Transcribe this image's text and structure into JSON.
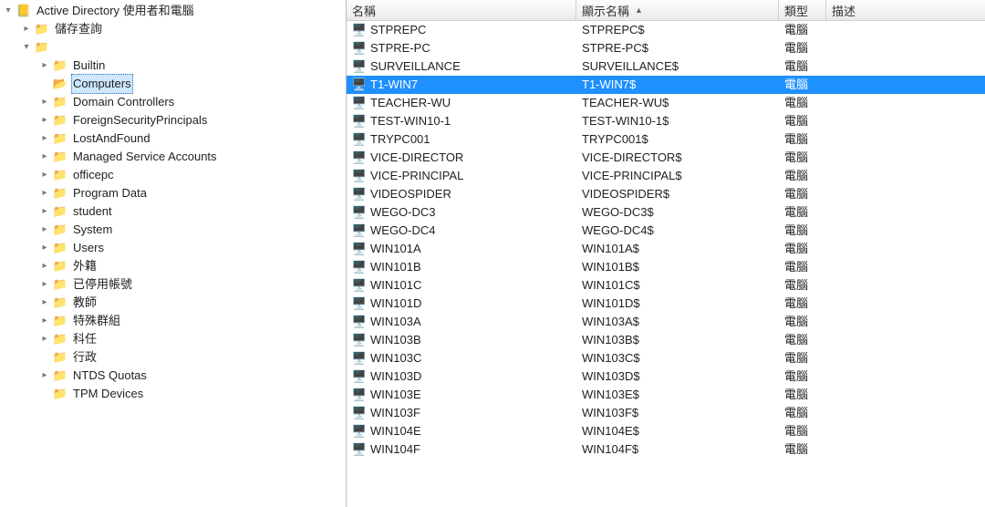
{
  "icons": {
    "folder": "📁",
    "folder_open": "📂",
    "ad_root": "📒",
    "container": "📁",
    "ou": "📁",
    "computer": "🖥️"
  },
  "colors": {
    "selection": "#1e90ff",
    "tree_selection": "#cde8ff",
    "border": "#bdbdbd"
  },
  "tree": {
    "root_label": "Active Directory 使用者和電腦",
    "nodes": [
      {
        "label": "儲存查詢",
        "depth": 1,
        "icon": "folder",
        "expander": "collapsed"
      },
      {
        "label": "",
        "depth": 1,
        "icon": "container",
        "expander": "expanded",
        "redacted": true
      },
      {
        "label": "Builtin",
        "depth": 2,
        "icon": "folder",
        "expander": "collapsed"
      },
      {
        "label": "Computers",
        "depth": 2,
        "icon": "folder_open",
        "expander": "none",
        "selected": true
      },
      {
        "label": "Domain Controllers",
        "depth": 2,
        "icon": "ou",
        "expander": "collapsed"
      },
      {
        "label": "ForeignSecurityPrincipals",
        "depth": 2,
        "icon": "folder",
        "expander": "collapsed"
      },
      {
        "label": "LostAndFound",
        "depth": 2,
        "icon": "folder",
        "expander": "collapsed"
      },
      {
        "label": "Managed Service Accounts",
        "depth": 2,
        "icon": "folder",
        "expander": "collapsed"
      },
      {
        "label": "officepc",
        "depth": 2,
        "icon": "ou",
        "expander": "collapsed"
      },
      {
        "label": "Program Data",
        "depth": 2,
        "icon": "folder",
        "expander": "collapsed"
      },
      {
        "label": "student",
        "depth": 2,
        "icon": "ou",
        "expander": "collapsed"
      },
      {
        "label": "System",
        "depth": 2,
        "icon": "folder",
        "expander": "collapsed"
      },
      {
        "label": "Users",
        "depth": 2,
        "icon": "folder",
        "expander": "collapsed"
      },
      {
        "label": "外籍",
        "depth": 2,
        "icon": "ou",
        "expander": "collapsed"
      },
      {
        "label": "已停用帳號",
        "depth": 2,
        "icon": "ou",
        "expander": "collapsed"
      },
      {
        "label": "教師",
        "depth": 2,
        "icon": "ou",
        "expander": "collapsed"
      },
      {
        "label": "特殊群組",
        "depth": 2,
        "icon": "ou",
        "expander": "collapsed"
      },
      {
        "label": "科任",
        "depth": 2,
        "icon": "ou",
        "expander": "collapsed"
      },
      {
        "label": "行政",
        "depth": 2,
        "icon": "ou",
        "expander": "none"
      },
      {
        "label": "NTDS Quotas",
        "depth": 2,
        "icon": "folder",
        "expander": "collapsed"
      },
      {
        "label": "TPM Devices",
        "depth": 2,
        "icon": "folder",
        "expander": "none"
      }
    ]
  },
  "list": {
    "columns": {
      "name": "名稱",
      "display": "顯示名稱",
      "type": "類型",
      "desc": "描述"
    },
    "sort_column": "display",
    "sort_direction": "asc",
    "type_label": "電腦",
    "rows": [
      {
        "name": "STPREPC",
        "display": "STPREPC$",
        "selected": false
      },
      {
        "name": "STPRE-PC",
        "display": "STPRE-PC$",
        "selected": false
      },
      {
        "name": "SURVEILLANCE",
        "display": "SURVEILLANCE$",
        "selected": false
      },
      {
        "name": "T1-WIN7",
        "display": "T1-WIN7$",
        "selected": true
      },
      {
        "name": "TEACHER-WU",
        "display": "TEACHER-WU$",
        "selected": false
      },
      {
        "name": "TEST-WIN10-1",
        "display": "TEST-WIN10-1$",
        "selected": false
      },
      {
        "name": "TRYPC001",
        "display": "TRYPC001$",
        "selected": false
      },
      {
        "name": "VICE-DIRECTOR",
        "display": "VICE-DIRECTOR$",
        "selected": false
      },
      {
        "name": "VICE-PRINCIPAL",
        "display": "VICE-PRINCIPAL$",
        "selected": false
      },
      {
        "name": "VIDEOSPIDER",
        "display": "VIDEOSPIDER$",
        "selected": false
      },
      {
        "name": "WEGO-DC3",
        "display": "WEGO-DC3$",
        "selected": false
      },
      {
        "name": "WEGO-DC4",
        "display": "WEGO-DC4$",
        "selected": false
      },
      {
        "name": "WIN101A",
        "display": "WIN101A$",
        "selected": false
      },
      {
        "name": "WIN101B",
        "display": "WIN101B$",
        "selected": false
      },
      {
        "name": "WIN101C",
        "display": "WIN101C$",
        "selected": false
      },
      {
        "name": "WIN101D",
        "display": "WIN101D$",
        "selected": false
      },
      {
        "name": "WIN103A",
        "display": "WIN103A$",
        "selected": false
      },
      {
        "name": "WIN103B",
        "display": "WIN103B$",
        "selected": false
      },
      {
        "name": "WIN103C",
        "display": "WIN103C$",
        "selected": false
      },
      {
        "name": "WIN103D",
        "display": "WIN103D$",
        "selected": false
      },
      {
        "name": "WIN103E",
        "display": "WIN103E$",
        "selected": false
      },
      {
        "name": "WIN103F",
        "display": "WIN103F$",
        "selected": false
      },
      {
        "name": "WIN104E",
        "display": "WIN104E$",
        "selected": false
      },
      {
        "name": "WIN104F",
        "display": "WIN104F$",
        "selected": false
      }
    ]
  }
}
